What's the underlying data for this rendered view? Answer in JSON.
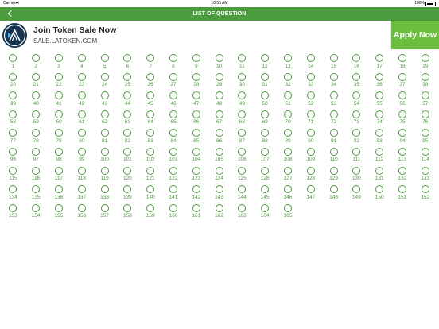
{
  "status_bar": {
    "carrier": "Carrier",
    "time": "10:56 AM",
    "battery": "100%",
    "icons": [
      "wifi-icon",
      "battery-icon"
    ]
  },
  "nav_bar": {
    "title": "LIST OF QUESTION",
    "back_icon": "chevron-left-icon",
    "color": "#4d9b3f"
  },
  "ad_banner": {
    "title": "Join Token Sale Now",
    "subtitle": "SALE.LATOKEN.COM",
    "button_label": "Apply Now",
    "button_color": "#6cbf3e",
    "logo_color": "#173553"
  },
  "questions": {
    "first": 1,
    "count": 165,
    "accent_color": "#4d9b3f"
  }
}
